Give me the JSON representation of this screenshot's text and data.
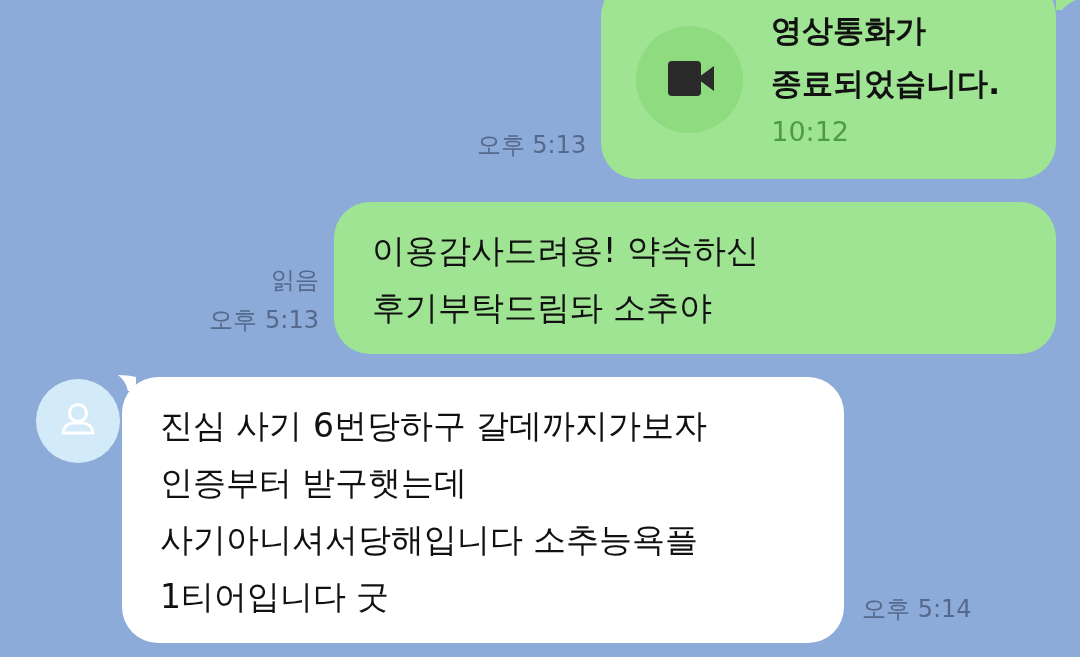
{
  "messages": [
    {
      "kind": "call",
      "sent": true,
      "title_lines": [
        "영상통화가",
        "종료되었습니다."
      ],
      "duration": "10:12",
      "time": "오후 5:13"
    },
    {
      "kind": "text",
      "sent": true,
      "lines": [
        "이용감사드려용! 약속하신",
        "후기부탁드림돠 소추야"
      ],
      "status": "읽음",
      "time": "오후 5:13"
    },
    {
      "kind": "text",
      "sent": false,
      "lines": [
        "진심 사기 6번당하구 갈데까지가보자",
        "인증부터 받구햇는데",
        "사기아니셔서당해입니다 소추능욕플",
        "1티어입니다 굿"
      ],
      "time": "오후 5:14"
    }
  ]
}
